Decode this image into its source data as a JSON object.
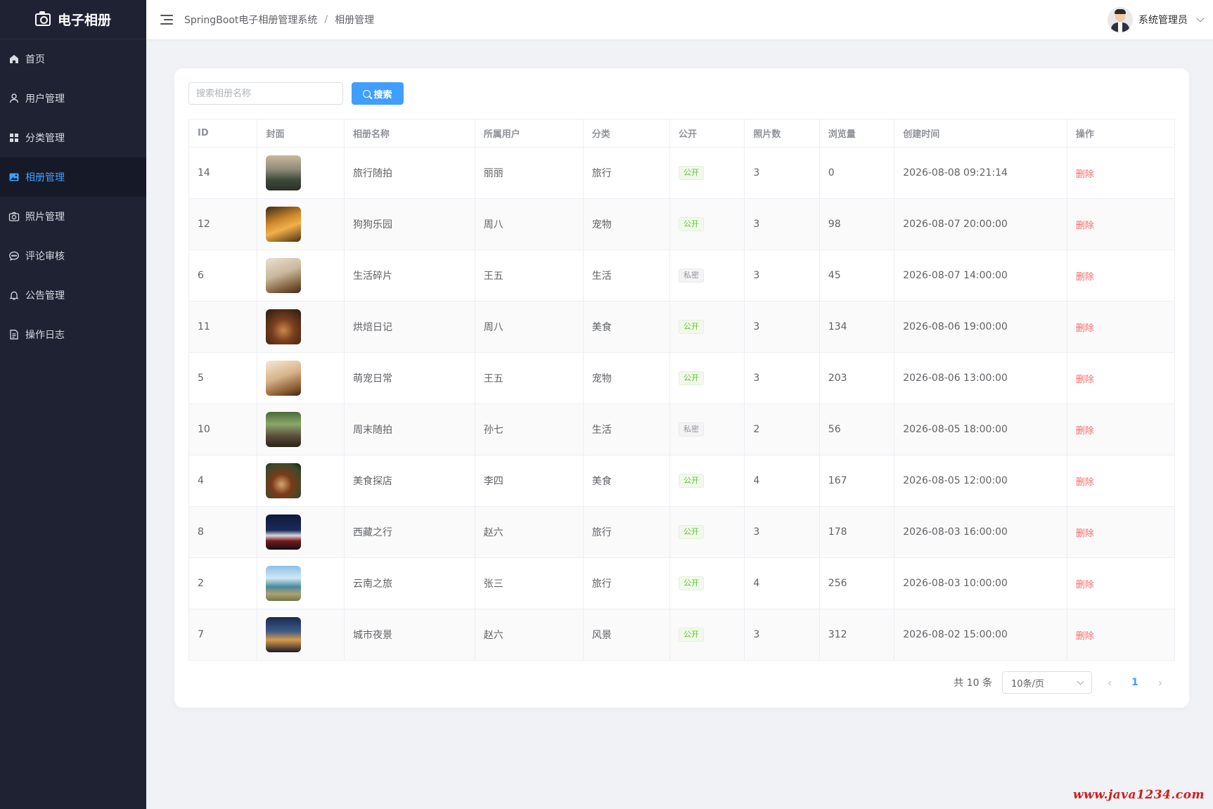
{
  "app": {
    "logo_text": "电子相册"
  },
  "sidebar": {
    "items": [
      {
        "label": "首页",
        "icon": "home-icon"
      },
      {
        "label": "用户管理",
        "icon": "user-icon"
      },
      {
        "label": "分类管理",
        "icon": "grid-icon"
      },
      {
        "label": "相册管理",
        "icon": "picture-icon",
        "active": true
      },
      {
        "label": "照片管理",
        "icon": "camera-icon"
      },
      {
        "label": "评论审核",
        "icon": "chat-icon"
      },
      {
        "label": "公告管理",
        "icon": "bell-icon"
      },
      {
        "label": "操作日志",
        "icon": "document-icon"
      }
    ]
  },
  "header": {
    "breadcrumb": [
      "SpringBoot电子相册管理系统",
      "相册管理"
    ],
    "separator": "/",
    "user_name": "系统管理员"
  },
  "search": {
    "placeholder": "搜索相册名称",
    "value": "",
    "button_label": "搜索"
  },
  "table": {
    "columns": [
      "ID",
      "封面",
      "相册名称",
      "所属用户",
      "分类",
      "公开",
      "照片数",
      "浏览量",
      "创建时间",
      "操作"
    ],
    "rows": [
      {
        "id": "14",
        "name": "旅行随拍",
        "user": "丽丽",
        "category": "旅行",
        "visibility": "公开",
        "photos": "3",
        "views": "0",
        "created": "2026-08-08 09:21:14",
        "action": "删除"
      },
      {
        "id": "12",
        "name": "狗狗乐园",
        "user": "周八",
        "category": "宠物",
        "visibility": "公开",
        "photos": "3",
        "views": "98",
        "created": "2026-08-07 20:00:00",
        "action": "删除"
      },
      {
        "id": "6",
        "name": "生活碎片",
        "user": "王五",
        "category": "生活",
        "visibility": "私密",
        "photos": "3",
        "views": "45",
        "created": "2026-08-07 14:00:00",
        "action": "删除"
      },
      {
        "id": "11",
        "name": "烘焙日记",
        "user": "周八",
        "category": "美食",
        "visibility": "公开",
        "photos": "3",
        "views": "134",
        "created": "2026-08-06 19:00:00",
        "action": "删除"
      },
      {
        "id": "5",
        "name": "萌宠日常",
        "user": "王五",
        "category": "宠物",
        "visibility": "公开",
        "photos": "3",
        "views": "203",
        "created": "2026-08-06 13:00:00",
        "action": "删除"
      },
      {
        "id": "10",
        "name": "周末随拍",
        "user": "孙七",
        "category": "生活",
        "visibility": "私密",
        "photos": "2",
        "views": "56",
        "created": "2026-08-05 18:00:00",
        "action": "删除"
      },
      {
        "id": "4",
        "name": "美食探店",
        "user": "李四",
        "category": "美食",
        "visibility": "公开",
        "photos": "4",
        "views": "167",
        "created": "2026-08-05 12:00:00",
        "action": "删除"
      },
      {
        "id": "8",
        "name": "西藏之行",
        "user": "赵六",
        "category": "旅行",
        "visibility": "公开",
        "photos": "3",
        "views": "178",
        "created": "2026-08-03 16:00:00",
        "action": "删除"
      },
      {
        "id": "2",
        "name": "云南之旅",
        "user": "张三",
        "category": "旅行",
        "visibility": "公开",
        "photos": "4",
        "views": "256",
        "created": "2026-08-03 10:00:00",
        "action": "删除"
      },
      {
        "id": "7",
        "name": "城市夜景",
        "user": "赵六",
        "category": "风景",
        "visibility": "公开",
        "photos": "3",
        "views": "312",
        "created": "2026-08-02 15:00:00",
        "action": "删除"
      }
    ]
  },
  "pagination": {
    "total_text": "共 10 条",
    "page_size": "10条/页",
    "current_page": "1",
    "prev": "‹",
    "next": "›"
  },
  "watermark": "www.java1234.com",
  "colors": {
    "sidebar_bg": "#1f2233",
    "accent": "#409eff",
    "danger": "#f56c6c",
    "success": "#67c23a"
  }
}
